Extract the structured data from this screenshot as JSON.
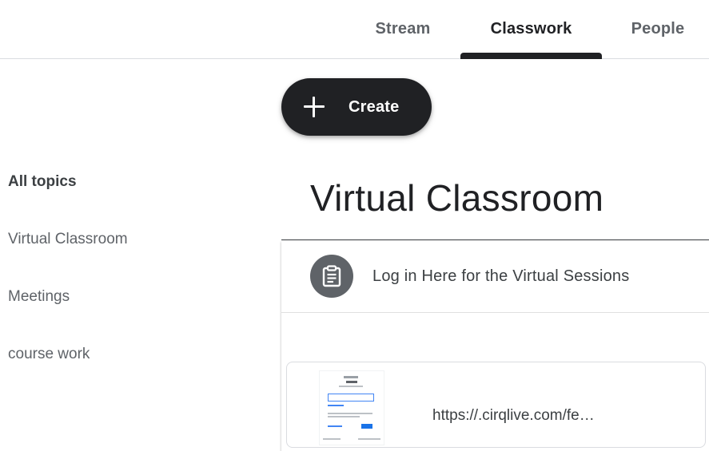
{
  "tabs": [
    {
      "label": "Stream",
      "selected": false
    },
    {
      "label": "Classwork",
      "selected": true
    },
    {
      "label": "People",
      "selected": false
    }
  ],
  "create_button": {
    "label": "Create",
    "icon": "plus-icon"
  },
  "topics": [
    {
      "label": "All topics",
      "selected": true
    },
    {
      "label": "Virtual Classroom",
      "selected": false
    },
    {
      "label": "Meetings",
      "selected": false
    },
    {
      "label": "course work",
      "selected": false
    }
  ],
  "section": {
    "title": "Virtual Classroom"
  },
  "material": {
    "title": "Log in Here for the Virtual Sessions",
    "icon": "assignment-icon",
    "attachment": {
      "url": "https://.cirqlive.com/fe…",
      "thumbnail": "sign-in-page-preview"
    }
  },
  "colors": {
    "accent": "#202124",
    "icon_bg": "#5f6368",
    "text": "#3c4043",
    "muted": "#5f6368"
  }
}
